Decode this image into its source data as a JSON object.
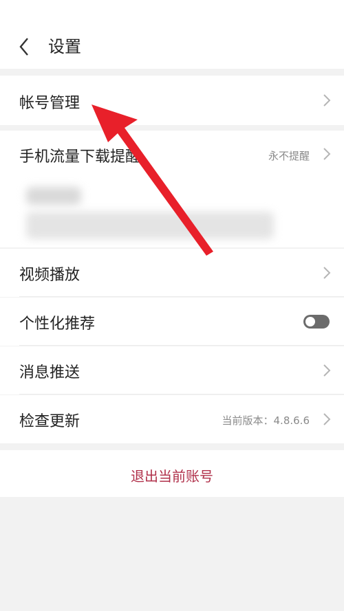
{
  "header": {
    "title": "设置"
  },
  "rows": {
    "account": {
      "label": "帐号管理"
    },
    "mobile_data": {
      "label": "手机流量下载提醒",
      "value": "永不提醒"
    },
    "video_play": {
      "label": "视频播放"
    },
    "personalized": {
      "label": "个性化推荐",
      "toggle_on": false
    },
    "push": {
      "label": "消息推送"
    },
    "update": {
      "label": "检查更新",
      "value": "当前版本：4.8.6.6"
    }
  },
  "logout": {
    "label": "退出当前账号"
  },
  "colors": {
    "accent": "#b0304a",
    "annotation_arrow": "#e8202a"
  }
}
